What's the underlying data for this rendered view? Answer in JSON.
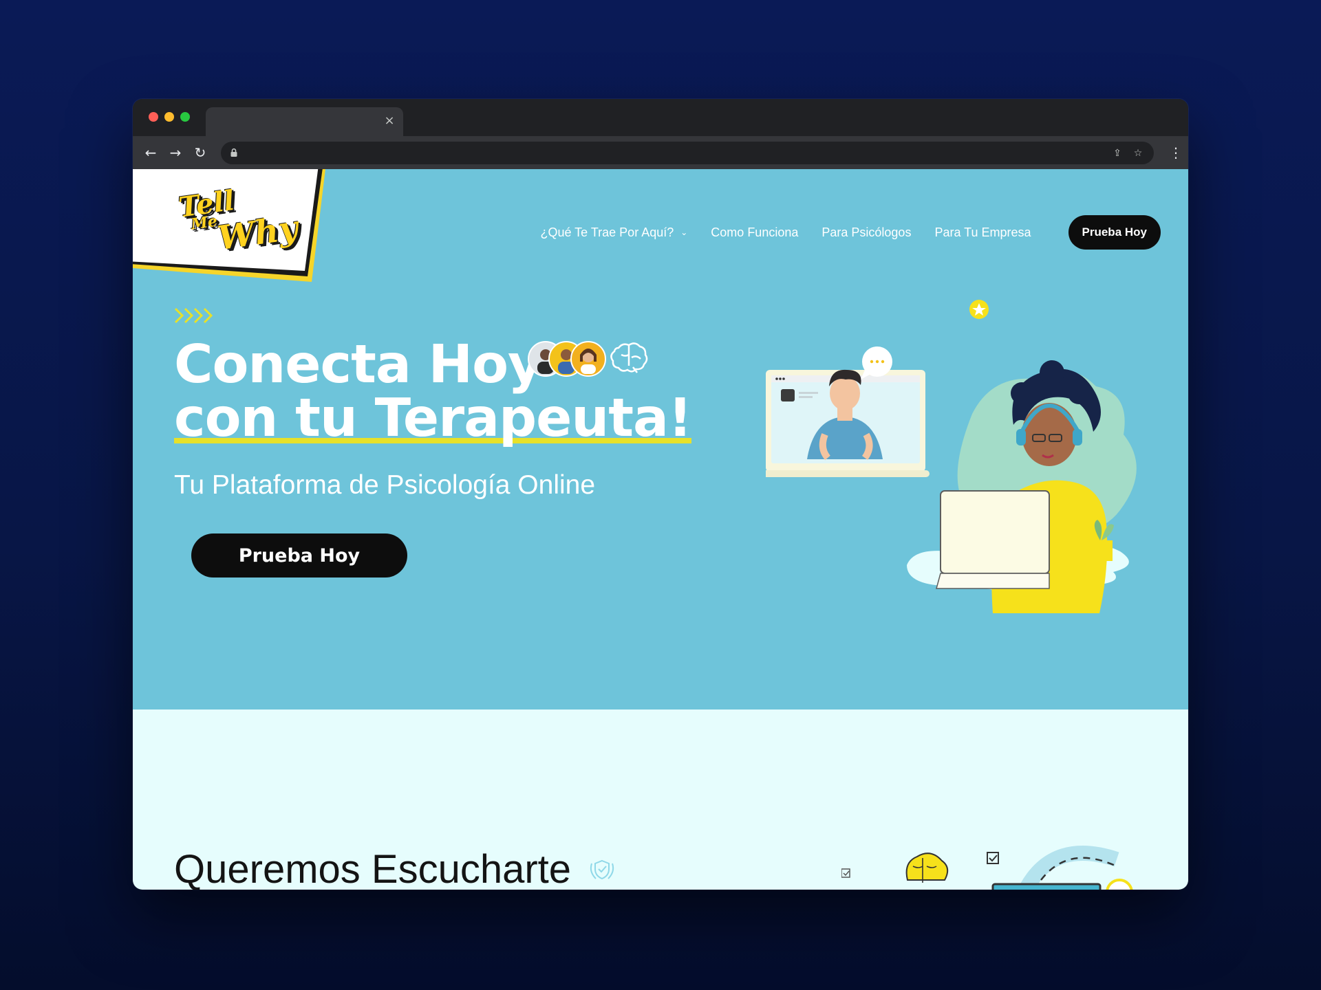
{
  "browser": {
    "tab_close": "×",
    "back_icon": "arrow-left-icon",
    "forward_icon": "arrow-right-icon",
    "reload_icon": "reload-icon",
    "menu_icon": "more-vert-icon"
  },
  "header": {
    "logo": {
      "line1": "Tell",
      "line2": "Me",
      "line3": "Why"
    },
    "nav": [
      {
        "label": "¿Qué Te Trae Por Aquí?",
        "has_dropdown": true
      },
      {
        "label": "Como Funciona"
      },
      {
        "label": "Para Psicólogos"
      },
      {
        "label": "Para Tu Empresa"
      }
    ],
    "cta": "Prueba Hoy"
  },
  "hero": {
    "title_line1": "Conecta Hoy",
    "title_line2": "con tu Terapeuta!",
    "subtitle": "Tu Plataforma de Psicología Online",
    "cta": "Prueba Hoy",
    "chat_bubble": "..."
  },
  "section": {
    "title": "Queremos Escucharte"
  },
  "colors": {
    "hero_bg": "#6ec4da",
    "section_bg": "#e6fdfd",
    "accent_yellow": "#ffd21f",
    "underline": "#e7e12a",
    "cta_bg": "#0d0d0d",
    "page_bg": "#081646"
  }
}
